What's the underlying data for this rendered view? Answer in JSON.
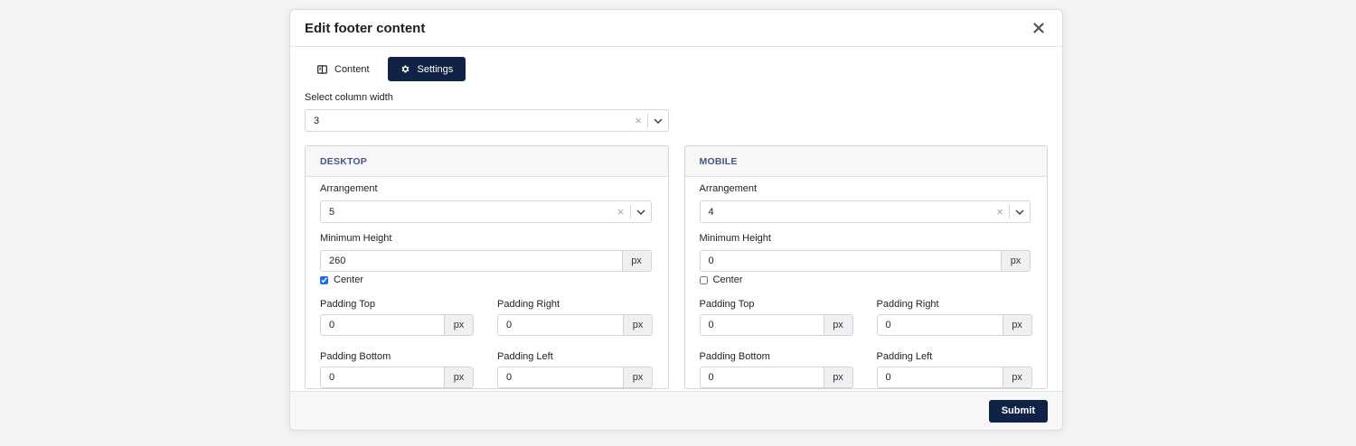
{
  "modal": {
    "title": "Edit footer content"
  },
  "tabs": [
    {
      "label": "Content",
      "icon": "book-icon",
      "active": false
    },
    {
      "label": "Settings",
      "icon": "gear-icon",
      "active": true
    }
  ],
  "column_width": {
    "label": "Select column width",
    "value": "3"
  },
  "desktop": {
    "heading": "DESKTOP",
    "arrangement_label": "Arrangement",
    "arrangement_value": "5",
    "min_height_label": "Minimum Height",
    "min_height_value": "260",
    "unit": "px",
    "center_label": "Center",
    "center_checked": true,
    "padding_top_label": "Padding Top",
    "padding_top_value": "0",
    "padding_right_label": "Padding Right",
    "padding_right_value": "0",
    "padding_bottom_label": "Padding Bottom",
    "padding_bottom_value": "0",
    "padding_left_label": "Padding Left",
    "padding_left_value": "0"
  },
  "mobile": {
    "heading": "MOBILE",
    "arrangement_label": "Arrangement",
    "arrangement_value": "4",
    "min_height_label": "Minimum Height",
    "min_height_value": "0",
    "unit": "px",
    "center_label": "Center",
    "center_checked": false,
    "padding_top_label": "Padding Top",
    "padding_top_value": "0",
    "padding_right_label": "Padding Right",
    "padding_right_value": "0",
    "padding_bottom_label": "Padding Bottom",
    "padding_bottom_value": "0",
    "padding_left_label": "Padding Left",
    "padding_left_value": "0"
  },
  "footer": {
    "submit_label": "Submit"
  },
  "colors": {
    "primary": "#102245",
    "panel_heading": "#4a5480",
    "checkbox": "#1a6ee6"
  }
}
